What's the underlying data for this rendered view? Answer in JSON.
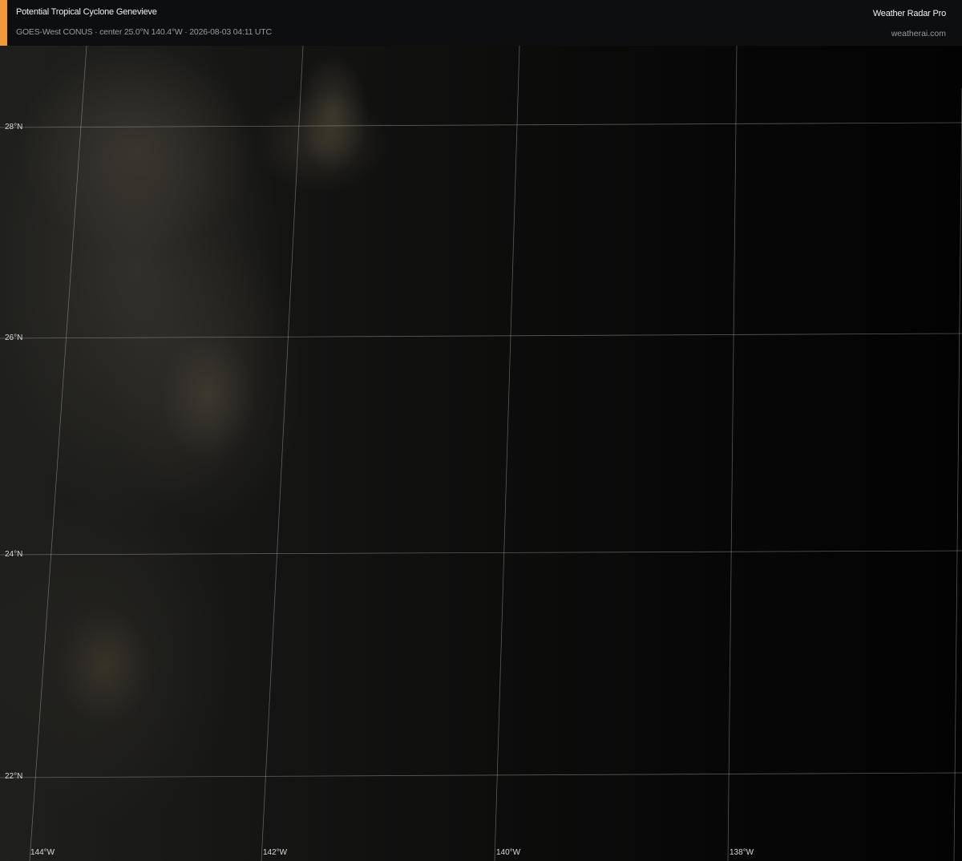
{
  "header": {
    "title": "Potential Tropical Cyclone Genevieve",
    "subtitle": "GOES-West CONUS · center 25.0°N 140.4°W · 2026-08-03 04:11 UTC",
    "brand": "Weather Radar Pro",
    "brand_url": "weatherai.com",
    "accent_color": "#f29a3a"
  },
  "map": {
    "latitude_labels": [
      "28°N",
      "26°N",
      "24°N",
      "22°N"
    ],
    "longitude_labels": [
      "144°W",
      "142°W",
      "140°W",
      "138°W"
    ],
    "grid_color": "#c8c8c8"
  }
}
